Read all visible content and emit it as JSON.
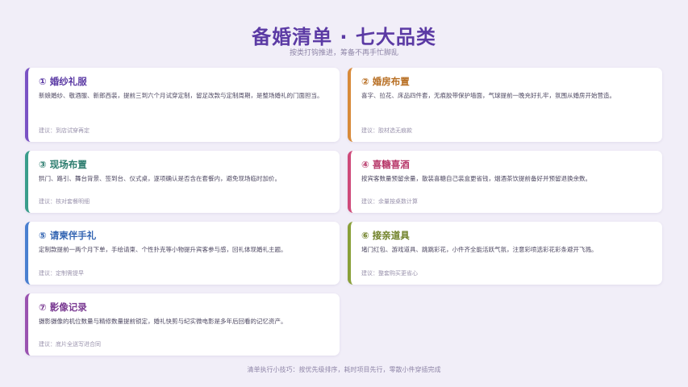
{
  "page": {
    "title": "备婚清单 · 七大品类",
    "subtitle": "按类打钩推进，筹备不再手忙脚乱",
    "footer": "清单执行小技巧：按优先级排序，耗时项目先行，零散小件穿插完成"
  },
  "cards": [
    {
      "title": "① 婚纱礼服",
      "desc": "新娘婚纱、敬酒服、新郎西装，提前三到六个月试穿定制，留足改款与定制周期，是整场婚礼的门面担当。",
      "suggest": "建议：到店试穿再定"
    },
    {
      "title": "② 婚房布置",
      "desc": "喜字、拉花、床品四件套，无痕胶带保护墙面，气球提前一晚充好扎牢，氛围从婚房开始营造。",
      "suggest": "建议：胶材选无痕款"
    },
    {
      "title": "③ 现场布置",
      "desc": "拱门、路引、舞台背景、签到台、仪式桌，逐项确认是否含在套餐内，避免现场临时加价。",
      "suggest": "建议：核对套餐明细"
    },
    {
      "title": "④ 喜糖喜酒",
      "desc": "按宾客数量预留余量，散装喜糖自己装盒更省钱，烟酒茶饮提前备好并预留退换余数。",
      "suggest": "建议：余量按桌数计算"
    },
    {
      "title": "⑤ 请柬伴手礼",
      "desc": "定制款提前一两个月下单，手绘请柬、个性扑克等小物提升宾客参与感，回礼体现婚礼主题。",
      "suggest": "建议：定制需提早"
    },
    {
      "title": "⑥ 接亲道具",
      "desc": "堵门红包、游戏道具、跳跳彩花，小件齐全能活跃气氛，注意彩喷选彩花彩条避开飞溅。",
      "suggest": "建议：整套购买更省心"
    },
    {
      "title": "⑦ 影像记录",
      "desc": "摄影摄像的机位数量与精修数量提前锁定，婚礼快剪与纪实微电影是多年后回看的记忆资产。",
      "suggest": "建议：底片全送写进合同"
    }
  ]
}
